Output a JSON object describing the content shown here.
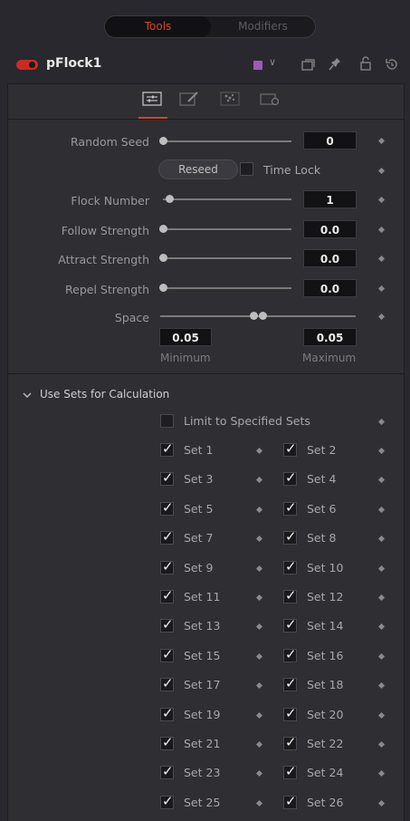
{
  "top_tabs": {
    "tools": "Tools",
    "modifiers": "Modifiers"
  },
  "header": {
    "tool_name": "pFlock1",
    "dropdown_chevron": "∨",
    "color_swatch": "#a058b8"
  },
  "inspector_tab_icons": [
    "controls-icon",
    "style-icon",
    "region-icon",
    "settings-icon"
  ],
  "params": {
    "random_seed": {
      "label": "Random Seed",
      "value": "0"
    },
    "reseed_label": "Reseed",
    "time_lock_label": "Time Lock",
    "flock_number": {
      "label": "Flock Number",
      "value": "1"
    },
    "follow_strength": {
      "label": "Follow Strength",
      "value": "0.0"
    },
    "attract_strength": {
      "label": "Attract Strength",
      "value": "0.0"
    },
    "repel_strength": {
      "label": "Repel Strength",
      "value": "0.0"
    },
    "space": {
      "label": "Space",
      "min_value": "0.05",
      "max_value": "0.05",
      "min_label": "Minimum",
      "max_label": "Maximum"
    }
  },
  "sets_section": {
    "title": "Use Sets for Calculation",
    "limit_label": "Limit to Specified Sets",
    "limit_checked": false,
    "sets": [
      "Set 1",
      "Set 2",
      "Set 3",
      "Set 4",
      "Set 5",
      "Set 6",
      "Set 7",
      "Set 8",
      "Set 9",
      "Set 10",
      "Set 11",
      "Set 12",
      "Set 13",
      "Set 14",
      "Set 15",
      "Set 16",
      "Set 17",
      "Set 18",
      "Set 19",
      "Set 20",
      "Set 21",
      "Set 22",
      "Set 23",
      "Set 24",
      "Set 25",
      "Set 26"
    ]
  }
}
